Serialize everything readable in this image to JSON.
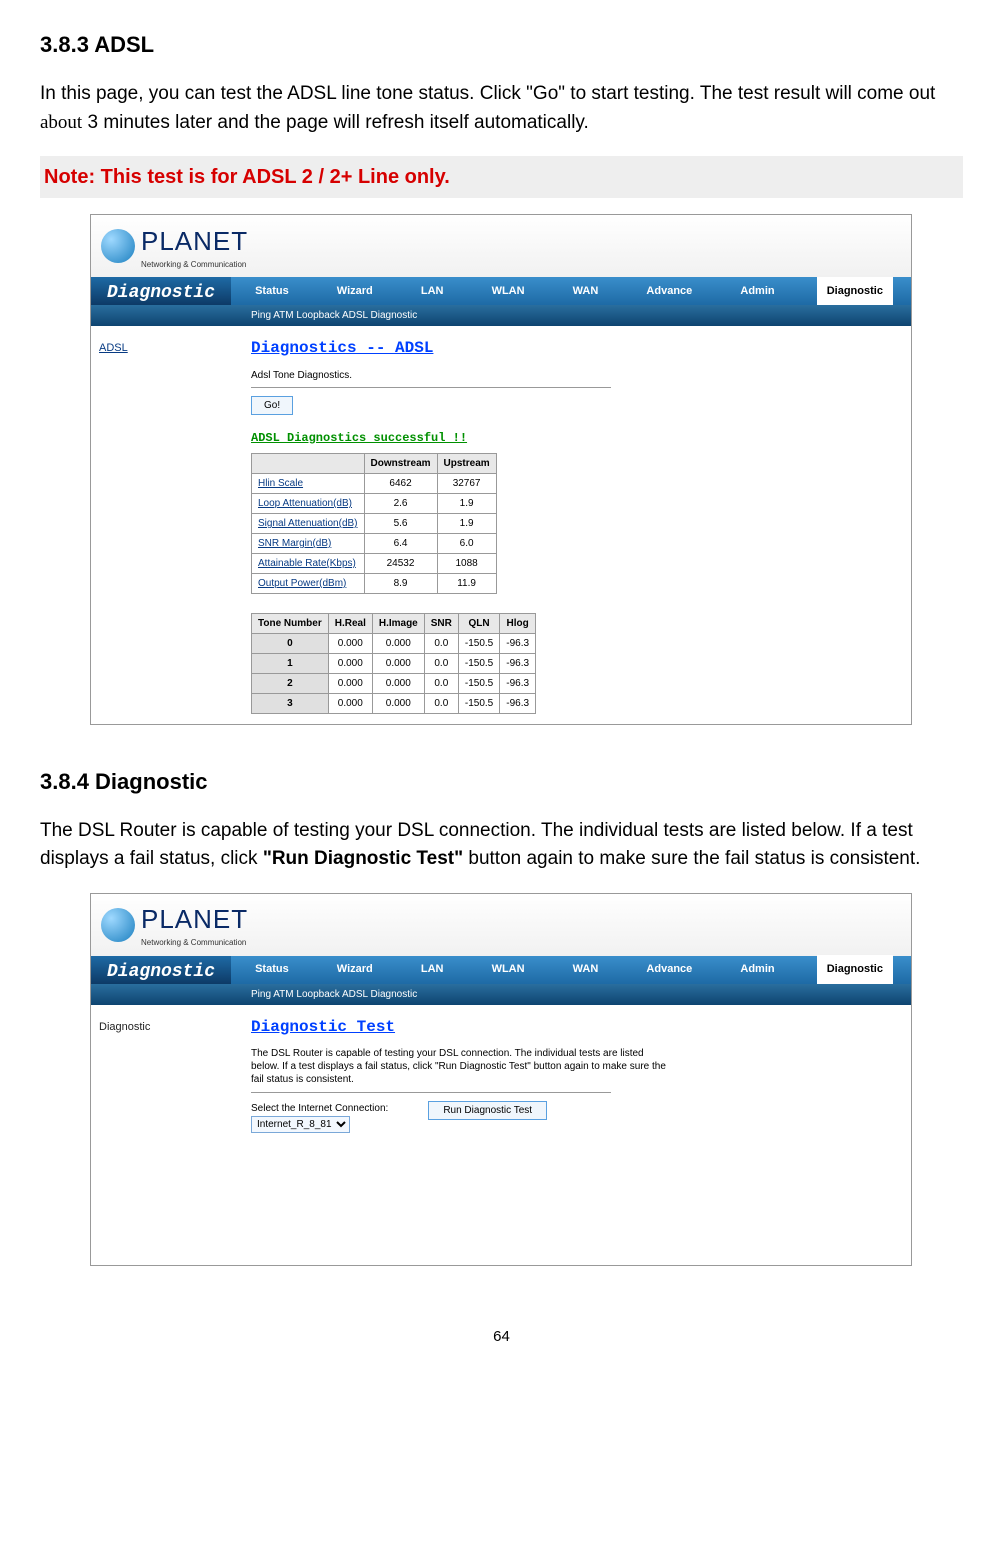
{
  "section1": {
    "heading": "3.8.3 ADSL",
    "para_a": "In this page, you can test the ADSL line tone status. Click \"Go\" to start testing. The test result will come out ",
    "about": "about",
    "para_b": " 3 minutes later and the page will refresh itself automatically.",
    "note": "Note: This test is for ADSL 2 / 2+ Line only."
  },
  "shot1": {
    "logo_text": "PLANET",
    "logo_sub": "Networking & Communication",
    "title": "Diagnostic",
    "nav": [
      "Status",
      "Wizard",
      "LAN",
      "WLAN",
      "WAN",
      "Advance",
      "Admin",
      "Diagnostic"
    ],
    "subnav": "Ping  ATM Loopback  ADSL  Diagnostic",
    "left_link": "ADSL",
    "content_title": "Diagnostics -- ADSL",
    "subtext": "Adsl Tone Diagnostics.",
    "go": "Go!",
    "success": "ADSL Diagnostics successful !!",
    "head_cols": [
      "",
      "Downstream",
      "Upstream"
    ],
    "rows": [
      {
        "label": "Hlin Scale",
        "d": "6462",
        "u": "32767"
      },
      {
        "label": "Loop Attenuation(dB)",
        "d": "2.6",
        "u": "1.9"
      },
      {
        "label": "Signal Attenuation(dB)",
        "d": "5.6",
        "u": "1.9"
      },
      {
        "label": "SNR Margin(dB)",
        "d": "6.4",
        "u": "6.0"
      },
      {
        "label": "Attainable Rate(Kbps)",
        "d": "24532",
        "u": "1088"
      },
      {
        "label": "Output Power(dBm)",
        "d": "8.9",
        "u": "11.9"
      }
    ],
    "tone_head": [
      "Tone Number",
      "H.Real",
      "H.Image",
      "SNR",
      "QLN",
      "Hlog"
    ],
    "tone_rows": [
      {
        "n": "0",
        "r": "0.000",
        "i": "0.000",
        "s": "0.0",
        "q": "-150.5",
        "h": "-96.3"
      },
      {
        "n": "1",
        "r": "0.000",
        "i": "0.000",
        "s": "0.0",
        "q": "-150.5",
        "h": "-96.3"
      },
      {
        "n": "2",
        "r": "0.000",
        "i": "0.000",
        "s": "0.0",
        "q": "-150.5",
        "h": "-96.3"
      },
      {
        "n": "3",
        "r": "0.000",
        "i": "0.000",
        "s": "0.0",
        "q": "-150.5",
        "h": "-96.3"
      }
    ]
  },
  "section2": {
    "heading": "3.8.4 Diagnostic",
    "para_a": "The DSL Router is capable of testing your DSL connection. The individual tests are listed below. If a test displays a fail status, click ",
    "bold": "\"Run Diagnostic Test\"",
    "para_b": " button again to make sure the fail status is consistent."
  },
  "shot2": {
    "title": "Diagnostic",
    "left_link": "Diagnostic",
    "content_title": "Diagnostic Test",
    "desc": "The DSL Router is capable of testing your DSL connection. The individual tests are listed below. If a test displays a fail status, click \"Run Diagnostic Test\" button again to make sure the fail status is consistent.",
    "sel_label": "Select the Internet Connection:",
    "sel_value": "Internet_R_8_81",
    "run": "Run Diagnostic Test"
  },
  "pagenum": "64"
}
